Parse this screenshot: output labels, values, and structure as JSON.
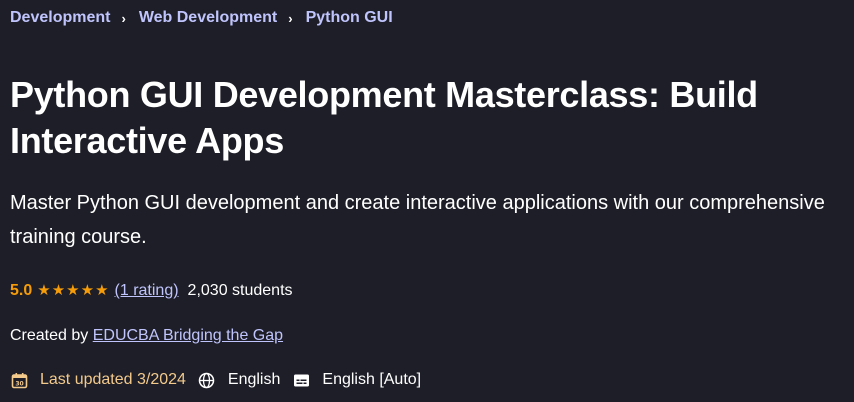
{
  "breadcrumb": {
    "items": [
      "Development",
      "Web Development",
      "Python GUI"
    ],
    "separator": "›"
  },
  "course": {
    "title": "Python GUI Development Masterclass: Build Interactive Apps",
    "subtitle": "Master Python GUI development and create interactive applications with our comprehensive training course."
  },
  "rating": {
    "value": "5.0",
    "stars": 5,
    "count_link": "(1 rating)",
    "students": "2,030 students"
  },
  "creator": {
    "prefix": "Created by ",
    "name": "EDUCBA Bridging the Gap"
  },
  "meta": {
    "updated": "Last updated 3/2024",
    "language": "English",
    "captions": "English [Auto]",
    "icons": {
      "updated": "calendar-icon",
      "language": "globe-icon",
      "captions": "captions-icon"
    }
  },
  "colors": {
    "background": "#1d1e27",
    "link": "#c0c4fc",
    "star": "#f69c08"
  }
}
